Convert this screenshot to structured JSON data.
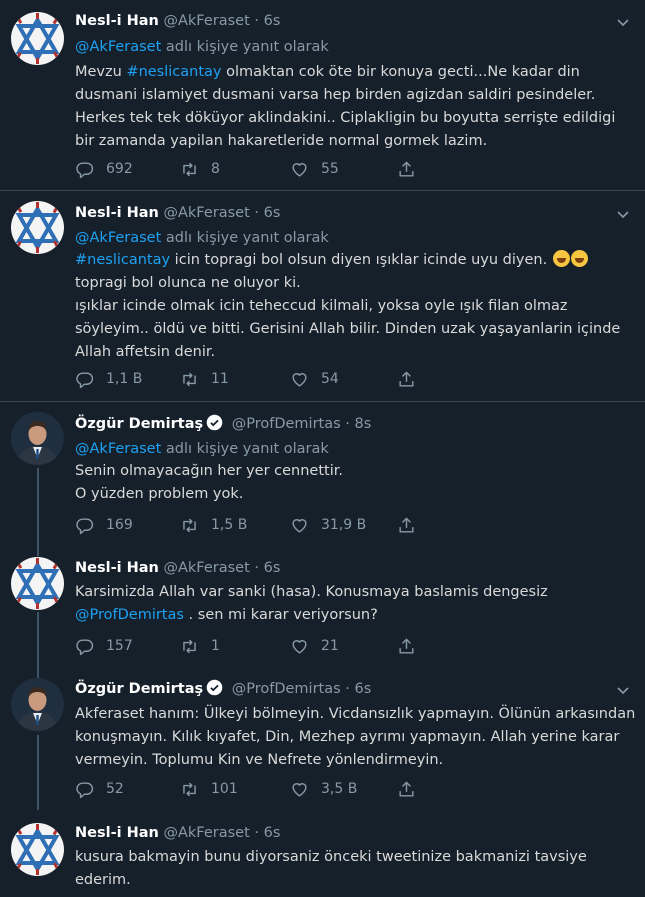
{
  "colors": {
    "background": "#15202b",
    "link": "#1da1f2",
    "muted": "#8899a6",
    "text": "#d9d9d9",
    "verified": "#ffffff"
  },
  "reply_prefix_suffix": "adlı kişiye yanıt olarak",
  "tweets": [
    {
      "name": "Nesl-i Han",
      "handle": "@AkFeraset",
      "sep": "·",
      "time": "6s",
      "verified": false,
      "reply_to": "@AkFeraset",
      "reply_suffix": "adlı kişiye yanıt olarak",
      "lines": [
        [
          "Mevzu ",
          "#neslicantay",
          " olmaktan cok öte bir konuya gecti...Ne kadar din"
        ],
        [
          "dusmani islamiyet dusmani varsa hep birden agizdan saldiri pesindeler."
        ],
        [
          "Herkes tek tek döküyor aklindakini.. Ciplakligin bu boyutta serrişte edildigi"
        ],
        [
          "bir zamanda yapilan hakaretleride normal gormek lazim."
        ]
      ],
      "replies": "692",
      "retweets": "8",
      "likes": "55"
    },
    {
      "name": "Nesl-i Han",
      "handle": "@AkFeraset",
      "sep": "·",
      "time": "6s",
      "verified": false,
      "reply_to": "@AkFeraset",
      "reply_suffix": "adlı kişiye yanıt olarak",
      "lines": [
        [
          "",
          "#neslicantay",
          " icin topragi bol olsun diyen ışıklar icinde uyu diyen. "
        ],
        [
          "topragi bol olunca ne oluyor ki."
        ],
        [
          "ışıklar icinde olmak icin teheccud kilmali, yoksa oyle ışık filan olmaz"
        ],
        [
          "söyleyim.. öldü ve bitti. Gerisini Allah bilir. Dinden uzak yaşayanlarin içinde"
        ],
        [
          "Allah affetsin denir."
        ]
      ],
      "replies": "1,1 B",
      "retweets": "11",
      "likes": "54"
    },
    {
      "name": "Özgür Demirtaş",
      "handle": "@ProfDemirtas",
      "sep": "·",
      "time": "8s",
      "verified": true,
      "reply_to": "@AkFeraset",
      "reply_suffix": "adlı kişiye yanıt olarak",
      "lines": [
        [
          "Senin olmayacağın her yer cennettir."
        ],
        [
          "O yüzden problem yok."
        ]
      ],
      "replies": "169",
      "retweets": "1,5 B",
      "likes": "31,9 B"
    },
    {
      "name": "Nesl-i Han",
      "handle": "@AkFeraset",
      "sep": "·",
      "time": "6s",
      "verified": false,
      "lines": [
        [
          "Karsimizda Allah var sanki (hasa).  Konusmaya baslamis dengesiz"
        ],
        [
          "",
          "@ProfDemirtas",
          " . sen mi karar veriyorsun?"
        ]
      ],
      "replies": "157",
      "retweets": "1",
      "likes": "21"
    },
    {
      "name": "Özgür Demirtaş",
      "handle": "@ProfDemirtas",
      "sep": "·",
      "time": "6s",
      "verified": true,
      "lines": [
        [
          "Akferaset hanım: Ülkeyi bölmeyin. Vicdansızlık yapmayın. Ölünün arkasından"
        ],
        [
          "konuşmayın. Kılık kıyafet, Din, Mezhep ayrımı yapmayın. Allah yerine karar"
        ],
        [
          "vermeyin. Toplumu Kin ve Nefrete yönlendirmeyin."
        ]
      ],
      "replies": "52",
      "retweets": "101",
      "likes": "3,5 B"
    },
    {
      "name": "Nesl-i Han",
      "handle": "@AkFeraset",
      "sep": "·",
      "time": "6s",
      "verified": false,
      "lines": [
        [
          "kusura bakmayin bunu diyorsaniz önceki tweetinize bakmanizi tavsiye"
        ],
        [
          "ederim."
        ]
      ]
    }
  ]
}
